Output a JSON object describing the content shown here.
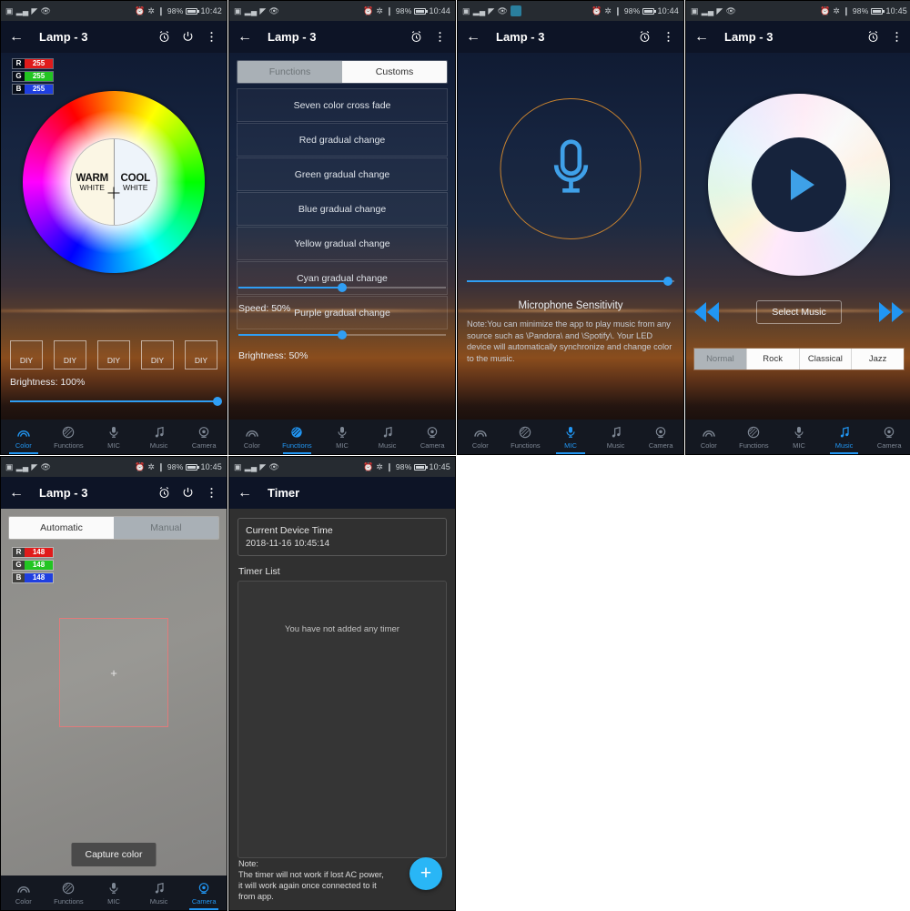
{
  "app": {
    "title": "Lamp - 3",
    "timer_title": "Timer"
  },
  "status_bars": [
    {
      "battery": "98%",
      "time": "10:42"
    },
    {
      "battery": "98%",
      "time": "10:44"
    },
    {
      "battery": "98%",
      "time": "10:44"
    },
    {
      "battery": "98%",
      "time": "10:45"
    },
    {
      "battery": "98%",
      "time": "10:45"
    },
    {
      "battery": "98%",
      "time": "10:45"
    }
  ],
  "icons": {
    "back": "back-arrow-icon",
    "alarm": "alarm-clock-icon",
    "power": "power-icon",
    "menu": "overflow-menu-icon"
  },
  "nav": {
    "items": [
      {
        "label": "Color",
        "icon": "rainbow-icon"
      },
      {
        "label": "Functions",
        "icon": "hatched-circle-icon"
      },
      {
        "label": "MIC",
        "icon": "microphone-icon"
      },
      {
        "label": "Music",
        "icon": "music-note-icon"
      },
      {
        "label": "Camera",
        "icon": "camera-icon"
      }
    ]
  },
  "colors": {
    "accent": "#2196f3",
    "appbar": "#0d1426",
    "navbar": "#141821",
    "mic_ring": "#c9832f",
    "capture_frame": "#e07b7b",
    "fab": "#29b6f6"
  },
  "panel_color": {
    "rgb": {
      "r_key": "R",
      "r_value": "255",
      "g_key": "G",
      "g_value": "255",
      "b_key": "B",
      "b_value": "255"
    },
    "wheel": {
      "warm_line1": "WARM",
      "warm_line2": "WHITE",
      "cool_line1": "COOL",
      "cool_line2": "WHITE"
    },
    "diy_buttons": [
      "DIY",
      "DIY",
      "DIY",
      "DIY",
      "DIY"
    ],
    "brightness_label": "Brightness: 100%",
    "brightness_value": 100,
    "active_tab": 0
  },
  "panel_functions": {
    "tabs": [
      {
        "label": "Functions",
        "selected": true
      },
      {
        "label": "Customs",
        "selected": false
      }
    ],
    "list": [
      "Seven color cross fade",
      "Red gradual change",
      "Green gradual change",
      "Blue gradual change",
      "Yellow gradual change",
      "Cyan gradual change",
      "Purple gradual change"
    ],
    "speed_label": "Speed: 50%",
    "speed_value": 50,
    "brightness_label": "Brightness: 50%",
    "brightness_value": 50,
    "active_tab": 1
  },
  "panel_mic": {
    "sensitivity_value": 95,
    "sensitivity_label": "Microphone Sensitivity",
    "note": "Note:You can minimize the app to play music from any source such as \\Pandora\\ and \\Spotify\\. Your LED device will automatically synchronize and change color to the music.",
    "mic_icon": "microphone-icon",
    "active_tab": 2
  },
  "panel_music": {
    "play_icon": "play-icon",
    "prev_label": "rewind-icon",
    "next_label": "fast-forward-icon",
    "select_music_label": "Select Music",
    "genres": [
      {
        "label": "Normal",
        "selected": true
      },
      {
        "label": "Rock",
        "selected": false
      },
      {
        "label": "Classical",
        "selected": false
      },
      {
        "label": "Jazz",
        "selected": false
      }
    ],
    "active_tab": 3
  },
  "panel_camera": {
    "tabs": [
      {
        "label": "Automatic",
        "selected": false
      },
      {
        "label": "Manual",
        "selected": true
      }
    ],
    "rgb": {
      "r_key": "R",
      "r_value": "148",
      "g_key": "G",
      "g_value": "148",
      "b_key": "B",
      "b_value": "148"
    },
    "crosshair": "+",
    "capture_label": "Capture color",
    "active_tab": 4
  },
  "panel_timer": {
    "current_time_label": "Current Device Time",
    "current_time_value": "2018-11-16 10:45:14",
    "timer_list_label": "Timer List",
    "empty_text": "You have not added any timer",
    "note_title": "Note:",
    "note_body": "The timer will not work if lost AC power, it will work again once connected to it from app.",
    "fab_label": "+"
  }
}
